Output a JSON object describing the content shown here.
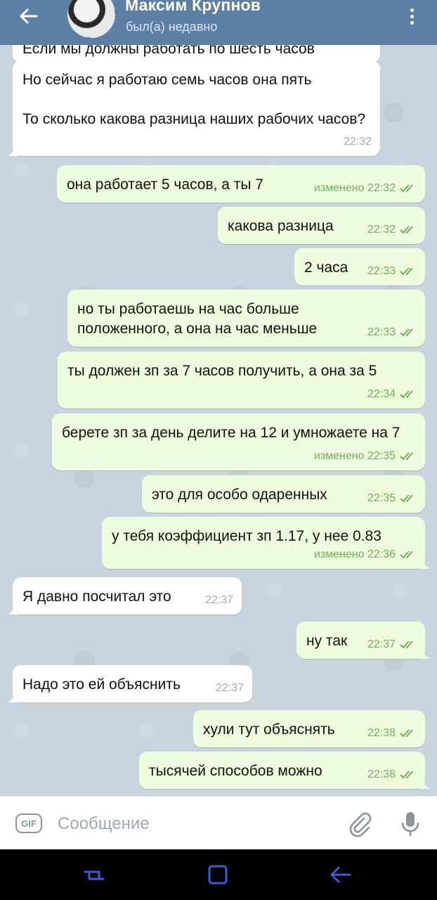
{
  "header": {
    "back_icon": "arrow-left-icon",
    "title": "Максим Крупнов",
    "status": "был(а) недавно",
    "menu_icon": "more-vertical-icon"
  },
  "messages": [
    {
      "dir": "in",
      "text": "Если мы должны работать по шесть часов",
      "time": ""
    },
    {
      "dir": "in",
      "text": "Но сейчас я работаю семь часов она пять\n\nТо сколько какова разница наших рабочих часов?",
      "time": "22:32"
    },
    {
      "dir": "out",
      "text": "она работает 5 часов, а ты 7",
      "time": "изменено 22:32"
    },
    {
      "dir": "out",
      "text": "какова разница",
      "time": "22:32"
    },
    {
      "dir": "out",
      "text": "2 часа",
      "time": "22:33"
    },
    {
      "dir": "out",
      "text": "но ты работаешь на час больше положенного, а она на час меньше",
      "time": "22:33"
    },
    {
      "dir": "out",
      "text": "ты должен зп за 7 часов получить, а она за 5",
      "time": "22:34"
    },
    {
      "dir": "out",
      "text": "берете зп за день делите на 12 и умножаете на 7",
      "time": "изменено 22:35"
    },
    {
      "dir": "out",
      "text": "это для особо одаренных",
      "time": "22:35"
    },
    {
      "dir": "out",
      "text": "у тебя коэффициент зп 1.17, у нее 0.83",
      "time": "изменено 22:36"
    },
    {
      "dir": "in",
      "text": "Я давно посчитал это",
      "time": "22:37"
    },
    {
      "dir": "out",
      "text": "ну так",
      "time": "22:37"
    },
    {
      "dir": "in",
      "text": "Надо это ей объяснить",
      "time": "22:37"
    },
    {
      "dir": "out",
      "text": "хули тут объяснять",
      "time": "22:38"
    },
    {
      "dir": "out",
      "text": "тысячей способов можно",
      "time": "22:38"
    }
  ],
  "input": {
    "gif_label": "GIF",
    "placeholder": "Сообщение",
    "attach_icon": "paperclip-icon",
    "mic_icon": "microphone-icon"
  },
  "colors": {
    "header": "#5b7fa5",
    "chat_background": "#c9d5de",
    "incoming_bubble": "#ffffff",
    "outgoing_bubble": "#effdde",
    "read_checks": "#6fae5c"
  }
}
